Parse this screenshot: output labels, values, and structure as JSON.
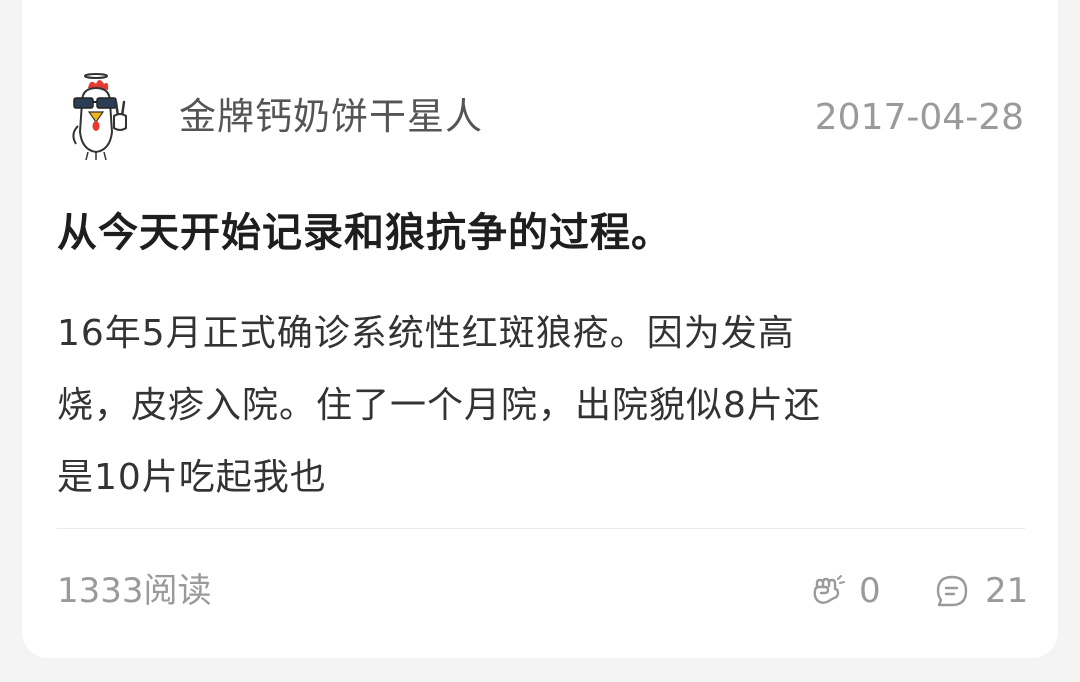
{
  "post": {
    "author": "金牌钙奶饼干星人",
    "date": "2017-04-28",
    "title": "从今天开始记录和狼抗争的过程。",
    "body_lines": [
      "16年5月正式确诊系统性红斑狼疮。因为发高",
      "烧，皮疹入院。住了一个月院，出院貌似8片还",
      "是10片吃起我也"
    ],
    "reads": "1333阅读",
    "likes": "0",
    "comments": "21"
  },
  "icons": {
    "avatar": "rooster-avatar",
    "like": "fist-icon",
    "comment": "comment-bubble-icon"
  },
  "colors": {
    "card_bg": "#ffffff",
    "page_bg": "#f4f4f4",
    "title_text": "#1e1e1e",
    "body_text": "#333333",
    "meta_text": "#9a9a9a"
  }
}
